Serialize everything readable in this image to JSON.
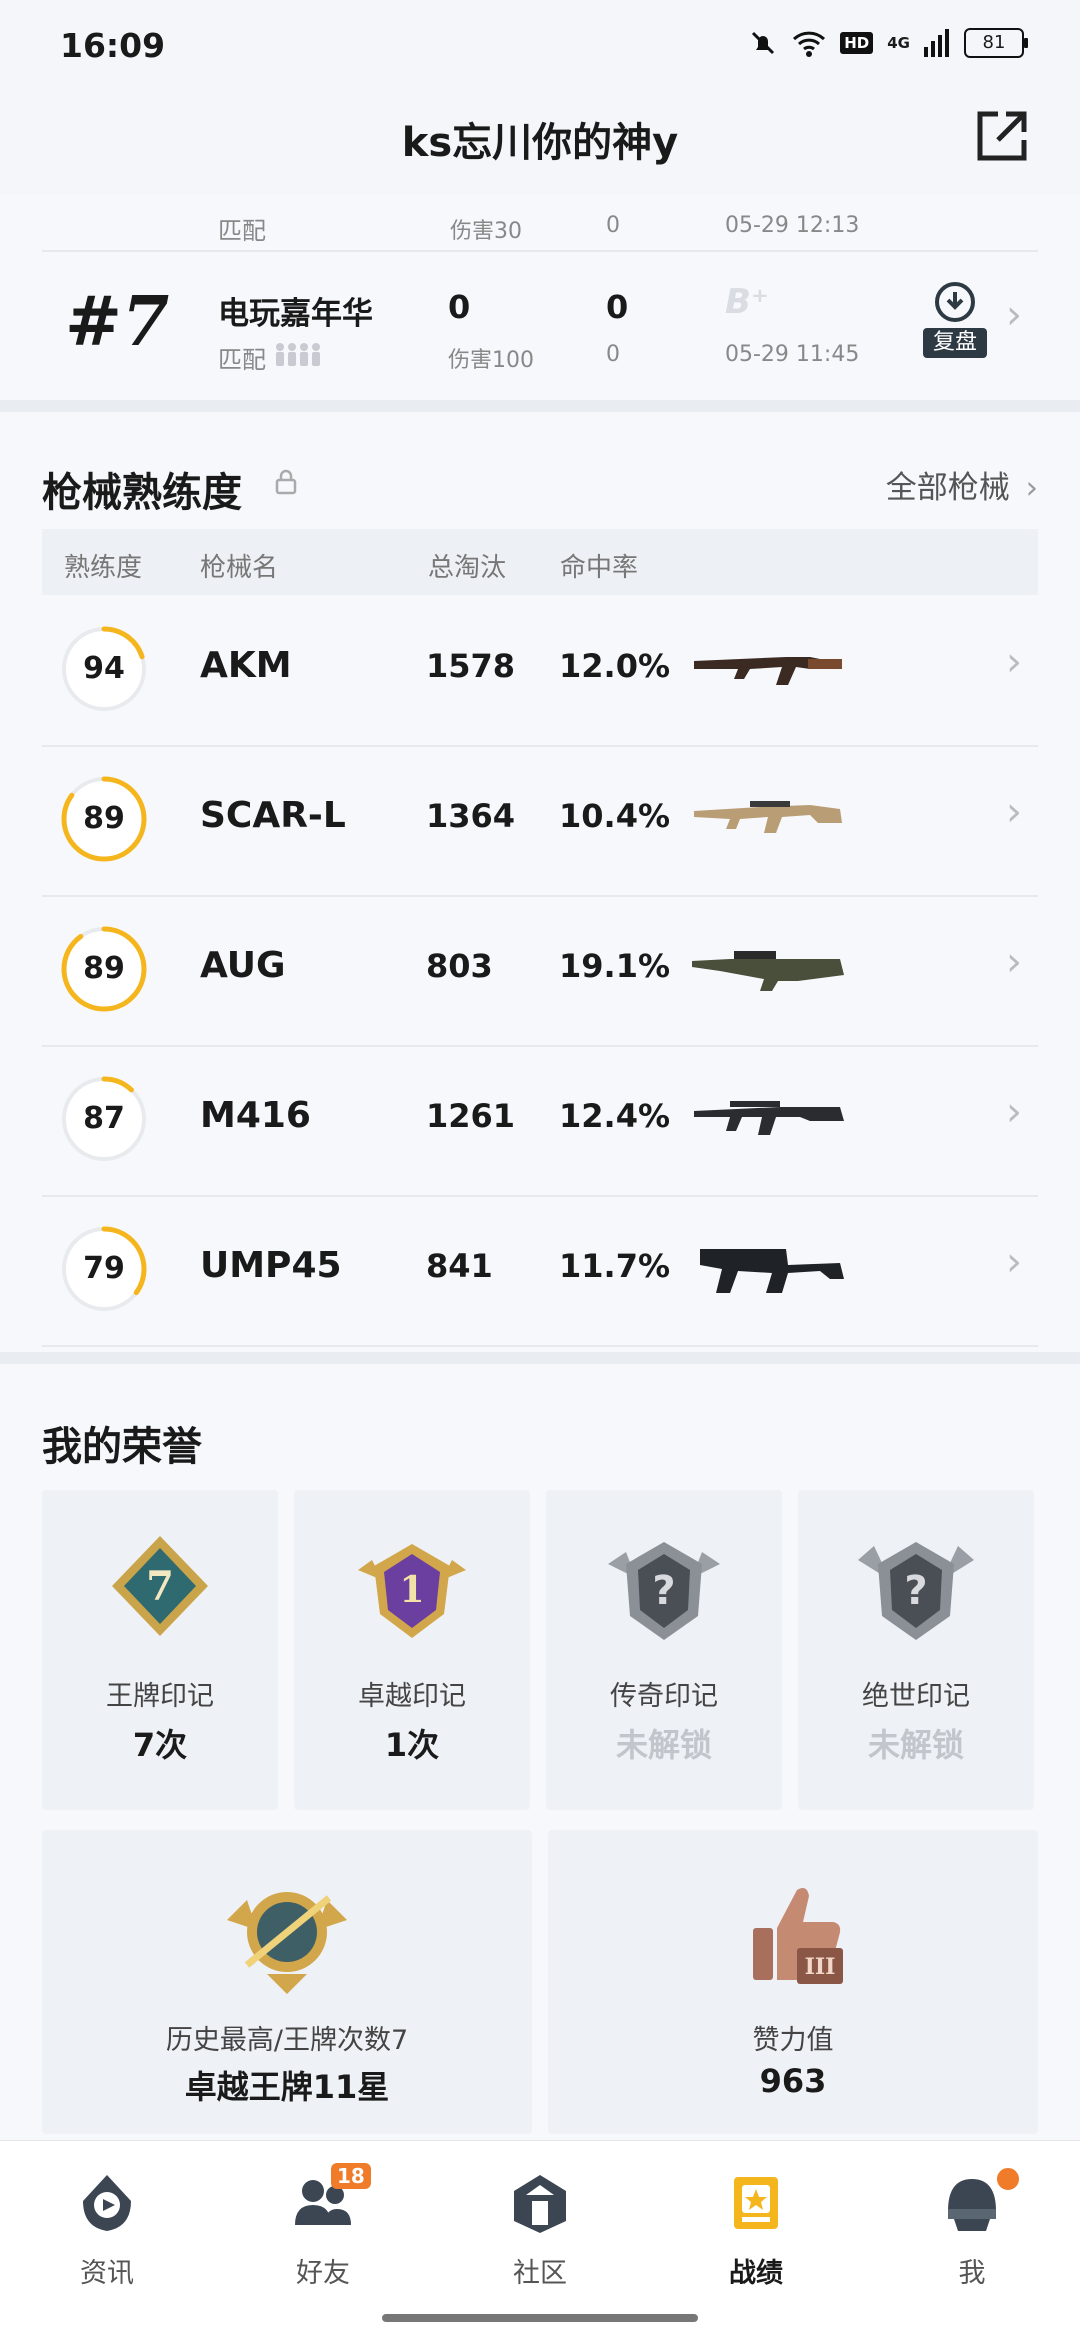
{
  "status_bar": {
    "time": "16:09",
    "network": "4G",
    "hd": "HD",
    "battery": "81"
  },
  "header": {
    "title": "ks忘川你的神y"
  },
  "matches": {
    "partial_row": {
      "mode": "匹配",
      "damage": "伤害30",
      "kills_sub": "0",
      "time": "05-29 12:13"
    },
    "row": {
      "rank": "#7",
      "mode": "电玩嘉年华",
      "mode_sub": "匹配",
      "kills": "0",
      "damage": "伤害100",
      "assists": "0",
      "assists_sub": "0",
      "grade": "B⁺",
      "time": "05-29 11:45",
      "replay": "复盘"
    }
  },
  "weapons": {
    "title": "枪械熟练度",
    "all_link": "全部枪械",
    "columns": [
      "熟练度",
      "枪械名",
      "总淘汰",
      "命中率"
    ],
    "items": [
      {
        "level": "94",
        "name": "AKM",
        "kills": "1578",
        "accuracy": "12.0%",
        "progress": 0.2,
        "icon": "akm-rifle-icon"
      },
      {
        "level": "89",
        "name": "SCAR-L",
        "kills": "1364",
        "accuracy": "10.4%",
        "progress": 0.85,
        "icon": "scar-rifle-icon"
      },
      {
        "level": "89",
        "name": "AUG",
        "kills": "803",
        "accuracy": "19.1%",
        "progress": 0.9,
        "icon": "aug-rifle-icon"
      },
      {
        "level": "87",
        "name": "M416",
        "kills": "1261",
        "accuracy": "12.4%",
        "progress": 0.12,
        "icon": "m416-rifle-icon"
      },
      {
        "level": "79",
        "name": "UMP45",
        "kills": "841",
        "accuracy": "11.7%",
        "progress": 0.35,
        "icon": "ump45-smg-icon"
      }
    ]
  },
  "honors": {
    "title": "我的荣誉",
    "marks": [
      {
        "name": "王牌印记",
        "value": "7次",
        "locked": false,
        "badge_text": "7"
      },
      {
        "name": "卓越印记",
        "value": "1次",
        "locked": false,
        "badge_text": "1"
      },
      {
        "name": "传奇印记",
        "value": "未解锁",
        "locked": true,
        "badge_text": "?"
      },
      {
        "name": "绝世印记",
        "value": "未解锁",
        "locked": true,
        "badge_text": "?"
      }
    ],
    "highest": {
      "name": "历史最高/王牌次数7",
      "value": "卓越王牌11星"
    },
    "likes": {
      "name": "赞力值",
      "value": "963"
    }
  },
  "bottom_nav": {
    "items": [
      {
        "label": "资讯",
        "icon": "news-icon"
      },
      {
        "label": "好友",
        "icon": "friends-icon",
        "badge": "18"
      },
      {
        "label": "社区",
        "icon": "community-icon"
      },
      {
        "label": "战绩",
        "icon": "record-icon",
        "active": true
      },
      {
        "label": "我",
        "icon": "profile-helmet-icon"
      }
    ]
  },
  "colors": {
    "accent": "#f5b51c",
    "ring_track": "#e8eaee",
    "badge": "#f07c2a"
  }
}
